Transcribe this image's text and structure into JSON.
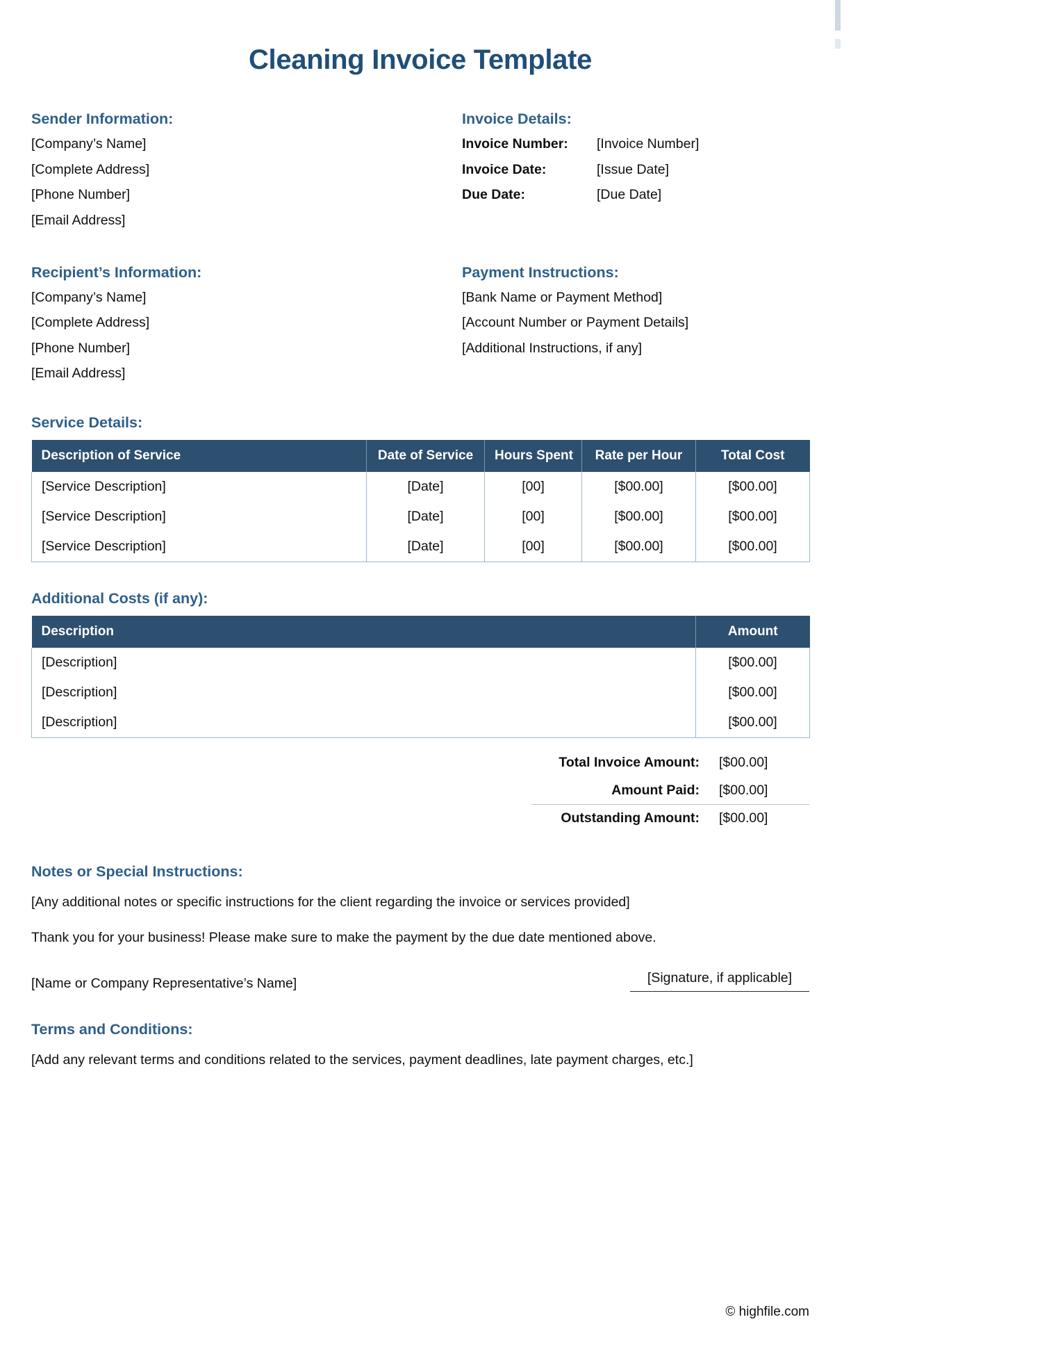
{
  "document": {
    "title": "Cleaning Invoice Template",
    "footer": "© highfile.com"
  },
  "sender": {
    "heading": "Sender Information:",
    "lines": [
      "[Company’s Name]",
      "[Complete Address]",
      "[Phone Number]",
      "[Email Address]"
    ]
  },
  "recipient": {
    "heading": "Recipient’s Information:",
    "lines": [
      "[Company’s Name]",
      "[Complete Address]",
      "[Phone Number]",
      "[Email Address]"
    ]
  },
  "invoice_details": {
    "heading": "Invoice Details:",
    "rows": [
      {
        "label": "Invoice Number:",
        "value": "[Invoice Number]"
      },
      {
        "label": "Invoice Date:",
        "value": "[Issue Date]"
      },
      {
        "label": "Due Date:",
        "value": "[Due Date]"
      }
    ]
  },
  "payment_instructions": {
    "heading": "Payment Instructions:",
    "lines": [
      "[Bank Name or Payment Method]",
      "[Account Number or Payment Details]",
      "[Additional Instructions, if any]"
    ]
  },
  "service_details": {
    "heading": "Service Details:",
    "columns": [
      "Description of Service",
      "Date of Service",
      "Hours Spent",
      "Rate per Hour",
      "Total Cost"
    ],
    "rows": [
      [
        "[Service Description]",
        "[Date]",
        "[00]",
        "[$00.00]",
        "[$00.00]"
      ],
      [
        "[Service Description]",
        "[Date]",
        "[00]",
        "[$00.00]",
        "[$00.00]"
      ],
      [
        "[Service Description]",
        "[Date]",
        "[00]",
        "[$00.00]",
        "[$00.00]"
      ]
    ]
  },
  "additional_costs": {
    "heading": "Additional Costs (if any):",
    "columns": [
      "Description",
      "Amount"
    ],
    "rows": [
      [
        "[Description]",
        "[$00.00]"
      ],
      [
        "[Description]",
        "[$00.00]"
      ],
      [
        "[Description]",
        "[$00.00]"
      ]
    ]
  },
  "totals": {
    "rows": [
      {
        "label": "Total Invoice Amount:",
        "amount": "[$00.00]"
      },
      {
        "label": "Amount Paid:",
        "amount": "[$00.00]"
      },
      {
        "label": "Outstanding Amount:",
        "amount": "[$00.00]"
      }
    ]
  },
  "notes": {
    "heading": "Notes or Special Instructions:",
    "placeholder": "[Any additional notes or specific instructions for the client regarding the invoice or services provided]",
    "thanks": "Thank you for your business! Please make sure to make the payment by the due date mentioned above.",
    "representative": "[Name or Company Representative’s Name]",
    "signature": "[Signature, if applicable]"
  },
  "terms": {
    "heading": "Terms and Conditions:",
    "text": "[Add any relevant terms and conditions related to the services, payment deadlines, late payment charges, etc.]"
  },
  "colors": {
    "title": "#1f4e79",
    "heading": "#2e5f8a",
    "table_header_bg": "#2d4f70",
    "table_border": "#9fb6c9"
  }
}
